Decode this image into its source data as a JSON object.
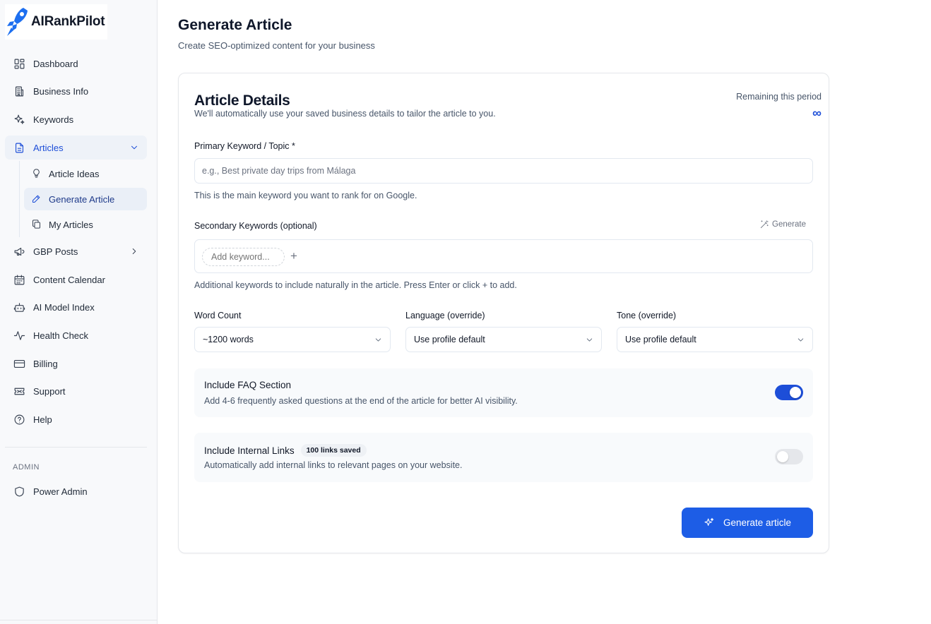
{
  "app": {
    "name": "AIRankPilot"
  },
  "sidebar": {
    "items": [
      {
        "label": "Dashboard",
        "icon": "dashboard-icon"
      },
      {
        "label": "Business Info",
        "icon": "building-icon"
      },
      {
        "label": "Keywords",
        "icon": "sparkles-icon"
      },
      {
        "label": "Articles",
        "icon": "document-icon",
        "expanded": true
      },
      {
        "label": "GBP Posts",
        "icon": "megaphone-icon"
      },
      {
        "label": "Content Calendar",
        "icon": "calendar-icon"
      },
      {
        "label": "AI Model Index",
        "icon": "bot-icon"
      },
      {
        "label": "Health Check",
        "icon": "activity-icon"
      },
      {
        "label": "Billing",
        "icon": "credit-card-icon"
      },
      {
        "label": "Support",
        "icon": "ticket-icon"
      },
      {
        "label": "Help",
        "icon": "help-circle-icon"
      }
    ],
    "sub_items": [
      {
        "label": "Article Ideas",
        "icon": "lightbulb-icon"
      },
      {
        "label": "Generate Article",
        "icon": "pencil-icon",
        "active": true
      },
      {
        "label": "My Articles",
        "icon": "copy-icon"
      }
    ],
    "admin_section": "ADMIN",
    "admin_items": [
      {
        "label": "Power Admin",
        "icon": "shield-icon"
      }
    ]
  },
  "page": {
    "title": "Generate Article",
    "subtitle": "Create SEO-optimized content for your business"
  },
  "card": {
    "title": "Article Details",
    "description": "We'll automatically use your saved business details to tailor the article to you.",
    "remaining_label": "Remaining this period",
    "remaining_value": "∞"
  },
  "form": {
    "primary": {
      "label": "Primary Keyword / Topic *",
      "placeholder": "e.g., Best private day trips from Málaga",
      "value": "",
      "hint": "This is the main keyword you want to rank for on Google."
    },
    "secondary": {
      "label": "Secondary Keywords (optional)",
      "generate_label": "Generate",
      "chip_placeholder": "Add keyword...",
      "add_symbol": "+",
      "hint": "Additional keywords to include naturally in the article. Press Enter or click + to add."
    },
    "word_count": {
      "label": "Word Count",
      "value": "~1200 words"
    },
    "language": {
      "label": "Language (override)",
      "value": "Use profile default"
    },
    "tone": {
      "label": "Tone (override)",
      "value": "Use profile default"
    },
    "faq": {
      "title": "Include FAQ Section",
      "description": "Add 4-6 frequently asked questions at the end of the article for better AI visibility.",
      "enabled": true
    },
    "internal_links": {
      "title": "Include Internal Links",
      "badge": "100 links saved",
      "description": "Automatically add internal links to relevant pages on your website.",
      "enabled": false
    },
    "submit_label": "Generate article"
  },
  "colors": {
    "accent": "#1d4ed8",
    "button": "#1d5de6",
    "sidebar_bg": "#f8f9fb",
    "active_bg": "#eaeff7"
  }
}
